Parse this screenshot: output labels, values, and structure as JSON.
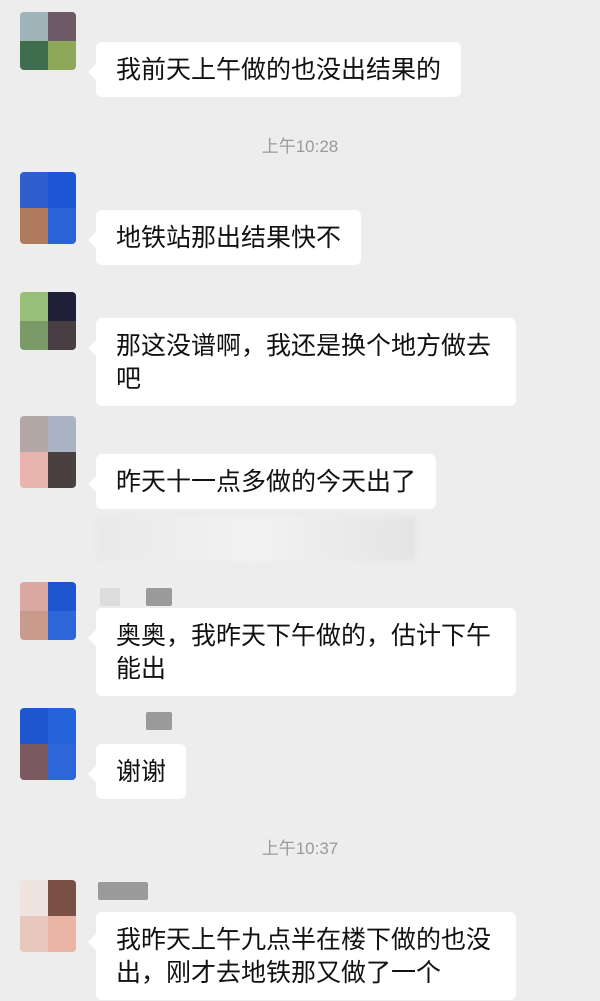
{
  "messages": [
    {
      "text": "我前天上午做的也没出结果的"
    },
    {
      "text": "地铁站那出结果快不"
    },
    {
      "text": "那这没谱啊，我还是换个地方做去\n吧"
    },
    {
      "text": "昨天十一点多做的今天出了"
    },
    {
      "text": "奥奥，我昨天下午做的，估计下午\n能出"
    },
    {
      "text": "谢谢"
    },
    {
      "text": "我昨天上午九点半在楼下做的也没\n出，刚才去地铁那又做了一个"
    }
  ],
  "timestamps": [
    "上午10:28",
    "上午10:37"
  ],
  "colors": {
    "background": "#ededed",
    "bubble": "#ffffff",
    "text": "#111111",
    "timestamp": "#9a9a9a"
  }
}
